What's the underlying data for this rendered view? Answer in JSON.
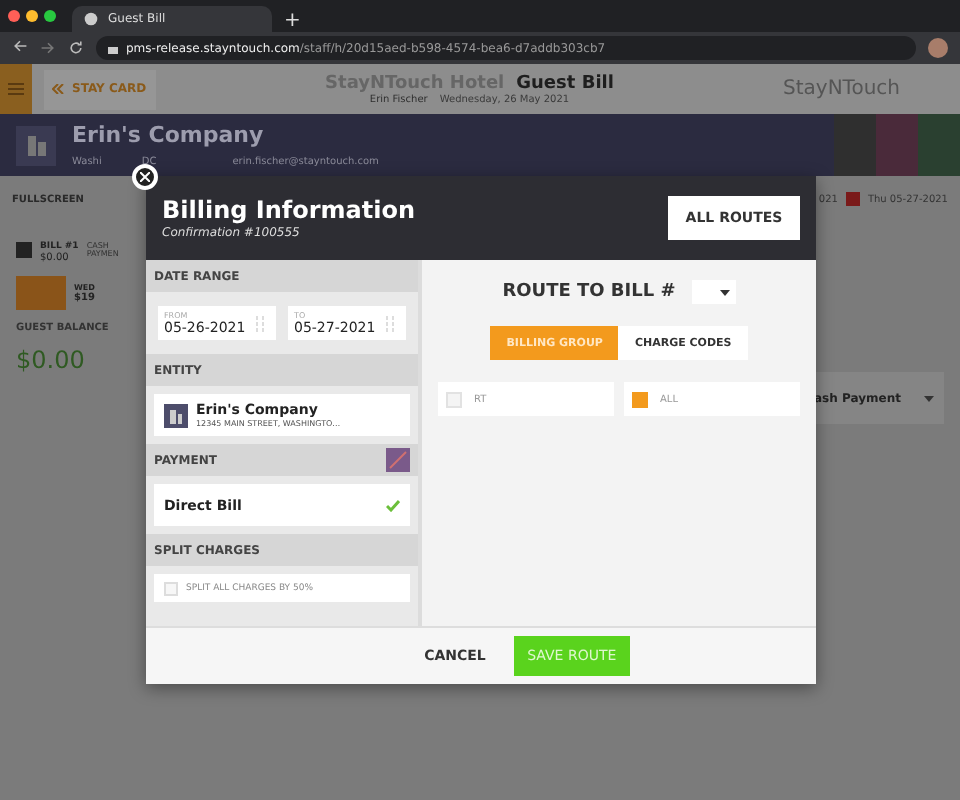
{
  "browser": {
    "tab_title": "Guest Bill",
    "new_tab": "+",
    "url_host": "pms-release.stayntouch.com",
    "url_path": "/staff/h/20d15aed-b598-4574-bea6-d7addb303cb7"
  },
  "header": {
    "stay_card": "STAY CARD",
    "hotel": "StayNTouch Hotel",
    "page": "Guest Bill",
    "user": "Erin Fischer",
    "date": "Wednesday, 26 May 2021",
    "logo": "StayNTouch"
  },
  "company": {
    "name": "Erin's Company",
    "location": [
      "Washi",
      "DC"
    ],
    "email": "erin.fischer@stayntouch.com"
  },
  "toolbar": {
    "fullscreen": "FULLSCREEN",
    "date_partial": "021",
    "date": "Thu 05-27-2021"
  },
  "bill": {
    "label": "BILL #1",
    "amount": "$0.00",
    "payment_label": "CASH PAYMEN",
    "day": "WED",
    "day_amount": "$19",
    "balance_label": "GUEST BALANCE",
    "balance": "$0.00",
    "payment_method": "ash Payment"
  },
  "modal": {
    "title": "Billing Information",
    "subtitle": "Confirmation #100555",
    "all_routes": "ALL ROUTES",
    "date_range": {
      "label": "DATE RANGE",
      "from": {
        "label": "FROM",
        "value": "05-26-2021"
      },
      "to": {
        "label": "TO",
        "value": "05-27-2021"
      }
    },
    "entity": {
      "label": "ENTITY",
      "name": "Erin's Company",
      "address": "12345 MAIN STREET, WASHINGTO…"
    },
    "payment": {
      "label": "PAYMENT",
      "method": "Direct Bill",
      "selected": true
    },
    "split": {
      "label": "SPLIT CHARGES",
      "option": "SPLIT ALL CHARGES BY 50%",
      "checked": false
    },
    "route": {
      "label": "ROUTE TO BILL #",
      "tabs": [
        {
          "label": "BILLING GROUP",
          "selected": true
        },
        {
          "label": "CHARGE CODES",
          "selected": false
        }
      ],
      "groups": [
        {
          "label": "RT",
          "checked": false
        },
        {
          "label": "ALL",
          "checked": true
        }
      ]
    },
    "buttons": {
      "cancel": "CANCEL",
      "save": "SAVE ROUTE"
    }
  }
}
